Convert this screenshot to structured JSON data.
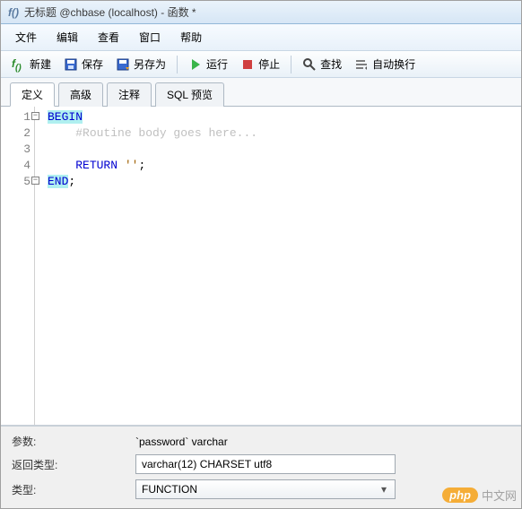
{
  "title": {
    "fx": "f()",
    "text": "无标题 @chbase (localhost) - 函数 *"
  },
  "menubar": [
    "文件",
    "编辑",
    "查看",
    "窗口",
    "帮助"
  ],
  "toolbar": {
    "new": "新建",
    "save": "保存",
    "saveas": "另存为",
    "run": "运行",
    "stop": "停止",
    "find": "查找",
    "wrap": "自动换行"
  },
  "tabs": {
    "def": "定义",
    "advanced": "高级",
    "comment": "注释",
    "sqlpreview": "SQL 预览"
  },
  "code": {
    "lines": [
      {
        "n": "1",
        "fold": true,
        "html": "<span class='hl'><span class='kw'>BEGIN</span></span>"
      },
      {
        "n": "2",
        "html": "    <span class='cmt'>#Routine body goes here...</span>"
      },
      {
        "n": "3",
        "html": ""
      },
      {
        "n": "4",
        "html": "    <span class='kw'>RETURN</span> <span class='str'>''</span>;"
      },
      {
        "n": "5",
        "fold": true,
        "html": "<span class='hl'><span class='kw'>END</span></span>;"
      }
    ]
  },
  "bottom": {
    "params_label": "参数:",
    "params_value": "`password` varchar",
    "ret_label": "返回类型:",
    "ret_value": "varchar(12) CHARSET utf8",
    "type_label": "类型:",
    "type_value": "FUNCTION"
  },
  "watermark": {
    "php": "php",
    "txt": "中文网"
  }
}
